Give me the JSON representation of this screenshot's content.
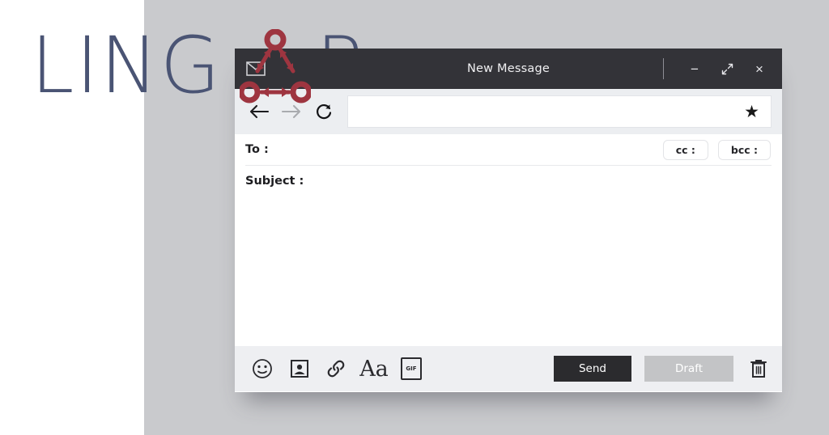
{
  "brand": {
    "text_left": "LING",
    "text_right": "R",
    "logo_icon": "triangle-rings-logo",
    "color": "#4a5474",
    "mark_color": "#9e3540"
  },
  "window": {
    "titlebar": {
      "mail_icon": "envelope-icon",
      "title": "New Message",
      "divider": "|",
      "minimize_label": "−",
      "maximize_label": "maximize-icon",
      "close_label": "×",
      "background": "#333338"
    },
    "navbar": {
      "back_icon": "arrow-left-icon",
      "forward_icon": "arrow-right-icon",
      "reload_icon": "reload-icon",
      "address_value": "",
      "address_placeholder": "",
      "bookmark_icon": "star-icon"
    },
    "compose": {
      "to_label": "To :",
      "to_value": "",
      "cc_label": "cc :",
      "bcc_label": "bcc :",
      "subject_label": "Subject :",
      "subject_value": "",
      "body_value": ""
    },
    "toolbar": {
      "emoji_icon": "smiley-icon",
      "image_icon": "photo-icon",
      "link_icon": "link-icon",
      "font_label": "Aa",
      "gif_label": "GIF",
      "send_label": "Send",
      "draft_label": "Draft",
      "trash_icon": "trash-icon",
      "send_color": "#2b2b2e",
      "draft_color": "#c3c4c6"
    }
  },
  "background": {
    "left_color": "#ffffff",
    "right_color": "#c9cacd"
  }
}
